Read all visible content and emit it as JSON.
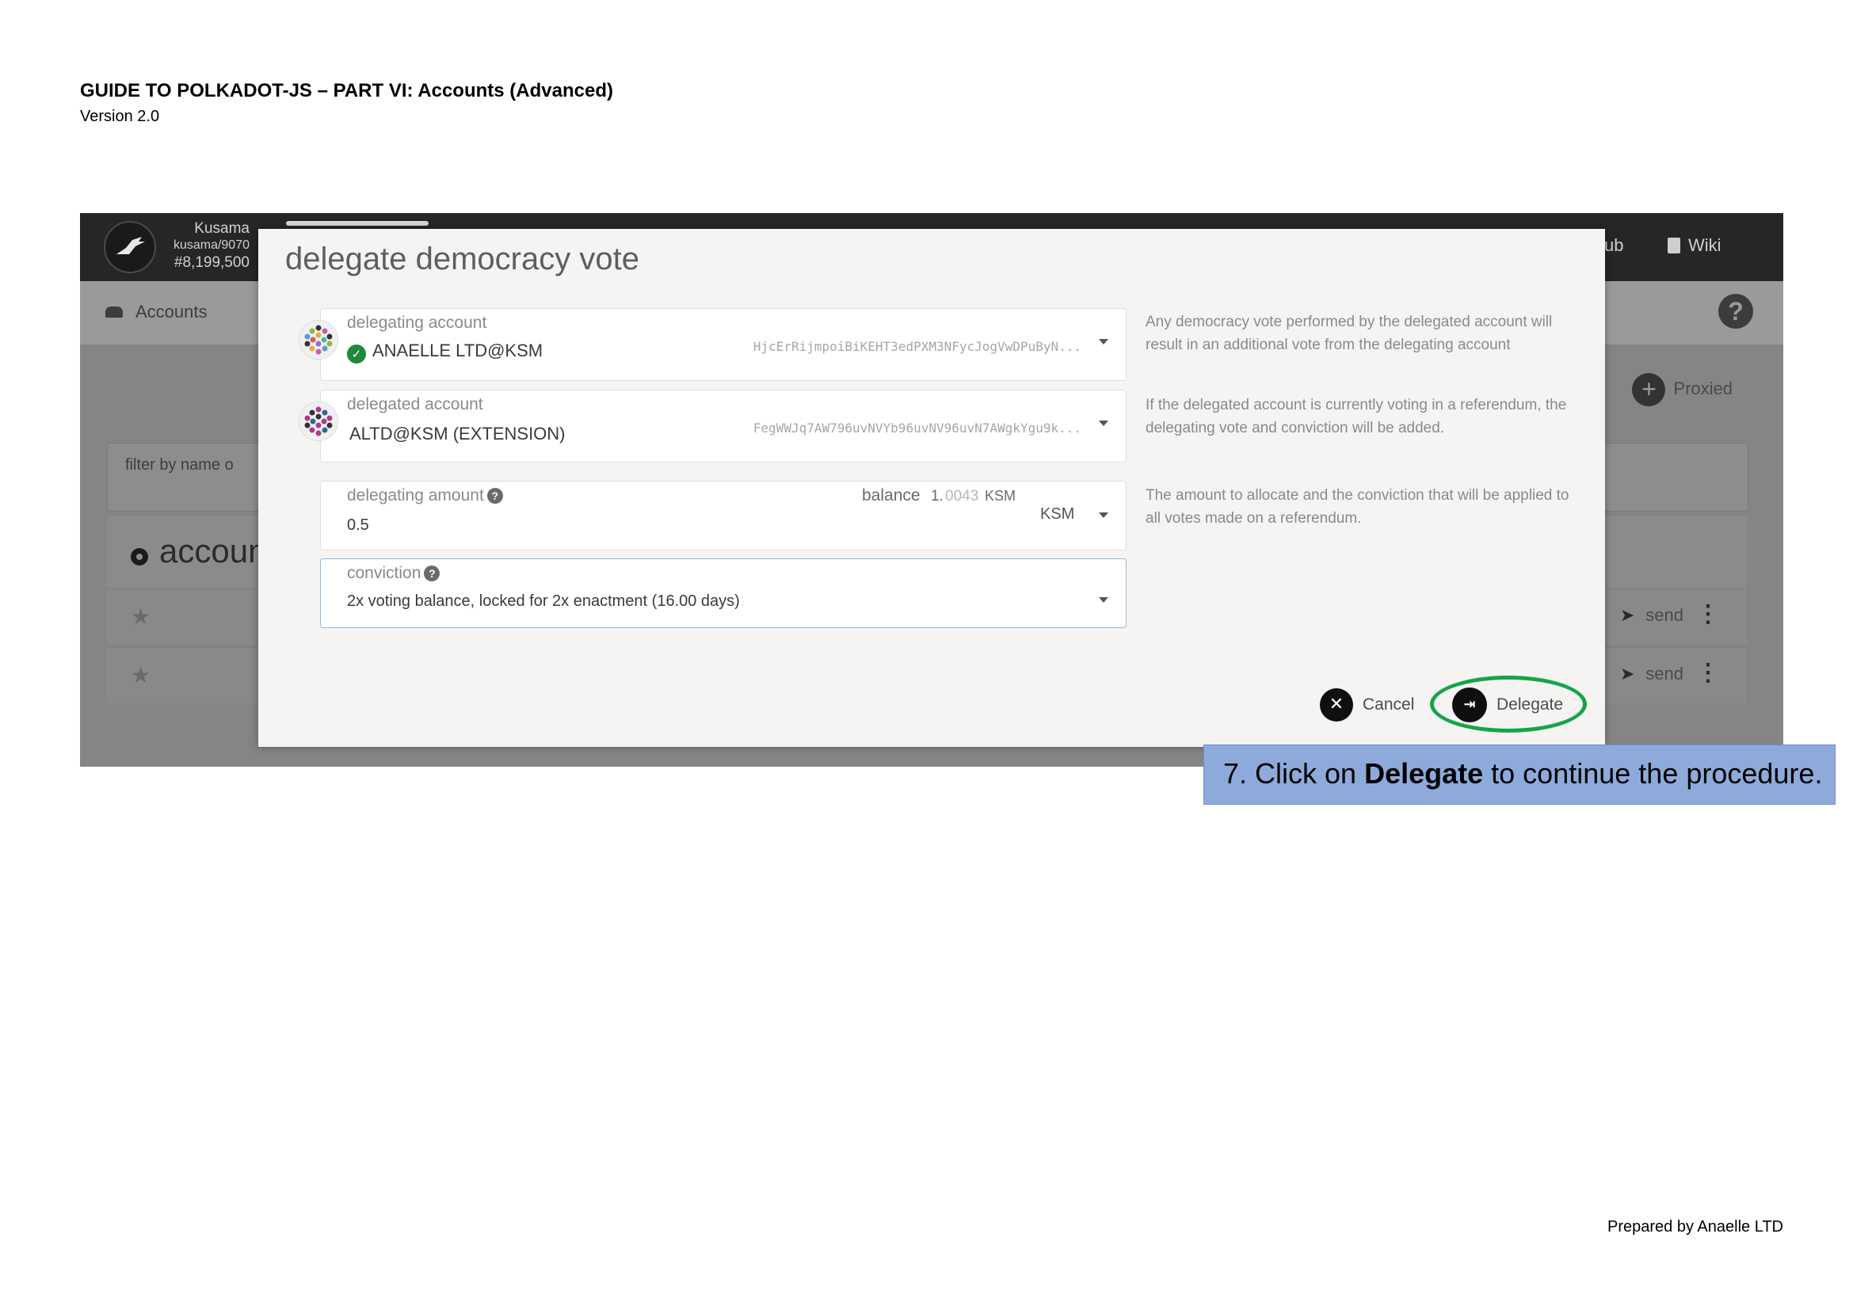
{
  "document": {
    "title": "GUIDE TO POLKADOT-JS – PART VI: Accounts (Advanced)",
    "version": "Version 2.0",
    "footer": "Prepared by Anaelle LTD"
  },
  "app": {
    "chain_name": "Kusama",
    "chain_path": "kusama/9070",
    "block_number": "#8,199,500",
    "top_links": [
      "ub",
      "Wiki"
    ],
    "sub_nav_label": "Accounts",
    "proxied_label": "Proxied",
    "filter_placeholder": "filter by name o",
    "accounts_heading": "account",
    "rows": [
      {
        "action": "send"
      },
      {
        "action": "send"
      }
    ]
  },
  "modal": {
    "title": "delegate democracy vote",
    "delegating_account": {
      "label": "delegating account",
      "name": "ANAELLE LTD@KSM",
      "address": "HjcErRijmpoiBiKEHT3edPXM3NFycJogVwDPuByN..."
    },
    "delegated_account": {
      "label": "delegated account",
      "name": "ALTD@KSM (EXTENSION)",
      "address": "FegWWJq7AW796uvNVYb96uvNV96uvN7AWgkYgu9k..."
    },
    "delegating_amount": {
      "label": "delegating amount",
      "value": "0.5",
      "balance_label": "balance",
      "balance_int": "1.",
      "balance_frac": "0043",
      "balance_unit": "KSM",
      "unit_selected": "KSM"
    },
    "conviction": {
      "label": "conviction",
      "value": "2x voting balance, locked for 2x enactment (16.00 days)"
    },
    "help_texts": [
      "Any democracy vote performed by the delegated account will result in an additional vote from the delegating account",
      "If the delegated account is currently voting in a referendum, the delegating vote and conviction will be added.",
      "The amount to allocate and the conviction that will be applied to all votes made on a referendum."
    ],
    "cancel_label": "Cancel",
    "delegate_label": "Delegate"
  },
  "callout": {
    "prefix": "7. Click on ",
    "bold": "Delegate",
    "suffix": " to continue the procedure."
  },
  "colors": {
    "highlight_ellipse": "#12a54a",
    "callout_background": "#8eaadb",
    "topbar": "#262626",
    "check_green": "#1f8a3a"
  }
}
